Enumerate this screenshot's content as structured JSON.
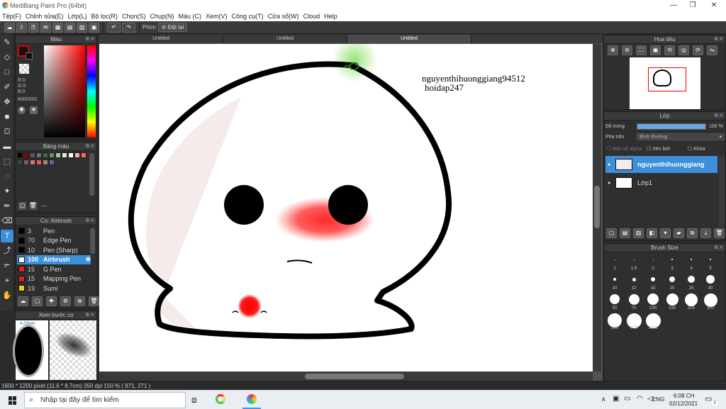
{
  "window": {
    "title": "MediBang Paint Pro (64bit)",
    "controls": [
      "—",
      "❐",
      "✕"
    ]
  },
  "menu": [
    "Tệp(F)",
    "Chỉnh sửa(E)",
    "Lớp(L)",
    "Bộ lọc(R)",
    "Chọn(S)",
    "Chụp(N)",
    "Màu (C)",
    "Xem(V)",
    "Công cụ(T)",
    "Cửa sổ(W)",
    "Cloud",
    "Help"
  ],
  "toolbar": {
    "shortcut_label": "Phím",
    "reset_label": "Đặt lại"
  },
  "color_panel": {
    "title": "Màu",
    "r": "R:0",
    "g": "G:0",
    "b": "B:0",
    "hex": "#000000"
  },
  "swatch_panel": {
    "title": "Bảng màu",
    "footer": "---",
    "colors": [
      "#000000",
      "#8b0000",
      "#5a5a5a",
      "#6f6f6f",
      "#3e6e3e",
      "#6a8f6a",
      "#9fcc9f",
      "#f2e0cf",
      "#ffffff",
      "#f0b0b0",
      "#ff6666",
      "#444444",
      "#666655",
      "#cc7777",
      "#ee5555",
      "#998877",
      "#5a6a99"
    ]
  },
  "brush_panel": {
    "title": "Cọ: Airbrush",
    "items": [
      {
        "size": "3",
        "name": "Pen",
        "color": "#000000",
        "selected": false
      },
      {
        "size": "70",
        "name": "Edge Pen",
        "color": "#000000",
        "selected": false
      },
      {
        "size": "10",
        "name": "Pen (Sharp)",
        "color": "#000000",
        "selected": false
      },
      {
        "size": "100",
        "name": "Airbrush",
        "color": "#ffffff",
        "selected": true
      },
      {
        "size": "15",
        "name": "G Pen",
        "color": "#dd2222",
        "selected": false
      },
      {
        "size": "15",
        "name": "Mapping Pen",
        "color": "#dd2222",
        "selected": false
      },
      {
        "size": "19",
        "name": "Sumi",
        "color": "#f0d020",
        "selected": false
      }
    ]
  },
  "preview_panel": {
    "title": "Xem trước cọ",
    "size_label": "4.23mm"
  },
  "tabs": [
    {
      "label": "Untitled",
      "active": false
    },
    {
      "label": "Untitled",
      "active": false
    },
    {
      "label": "Untitled",
      "active": true
    }
  ],
  "canvas": {
    "watermark1": "nguyenthihuonggiang94512",
    "watermark2": "hoidap247"
  },
  "status": {
    "text": "1600 * 1200 pixel   (11.6 * 8.7cm)   350 dpi   150 %   ( 971, 271 )"
  },
  "navigator": {
    "title": "Hoa tiêu"
  },
  "layer_panel": {
    "title": "Lớp",
    "opacity_label": "Độ trong",
    "opacity_value": "100 %",
    "opacity": 1.0,
    "blend_label": "Pha trộn",
    "blend_value": "Bình thường",
    "protect_alpha": "Bảo vệ alpha",
    "clipping": "Xén bớt",
    "lock": "Khóa",
    "layers": [
      {
        "name": "nguyenthihuonggiang",
        "selected": true
      },
      {
        "name": "Lớp1",
        "selected": false
      }
    ]
  },
  "brush_size_panel": {
    "title": "Brush Size",
    "sizes": [
      "1",
      "1.5",
      "2",
      "3",
      "4",
      "5",
      "10",
      "12",
      "15",
      "20",
      "25",
      "30",
      "50",
      "70",
      "100",
      "150",
      "200",
      "300",
      "500",
      "700",
      "1000"
    ]
  },
  "taskbar": {
    "search_placeholder": "Nhập tại đây để tìm kiếm",
    "lang": "ENG",
    "time": "6:08 CH",
    "date": "02/12/2021",
    "notif_count": "2"
  }
}
